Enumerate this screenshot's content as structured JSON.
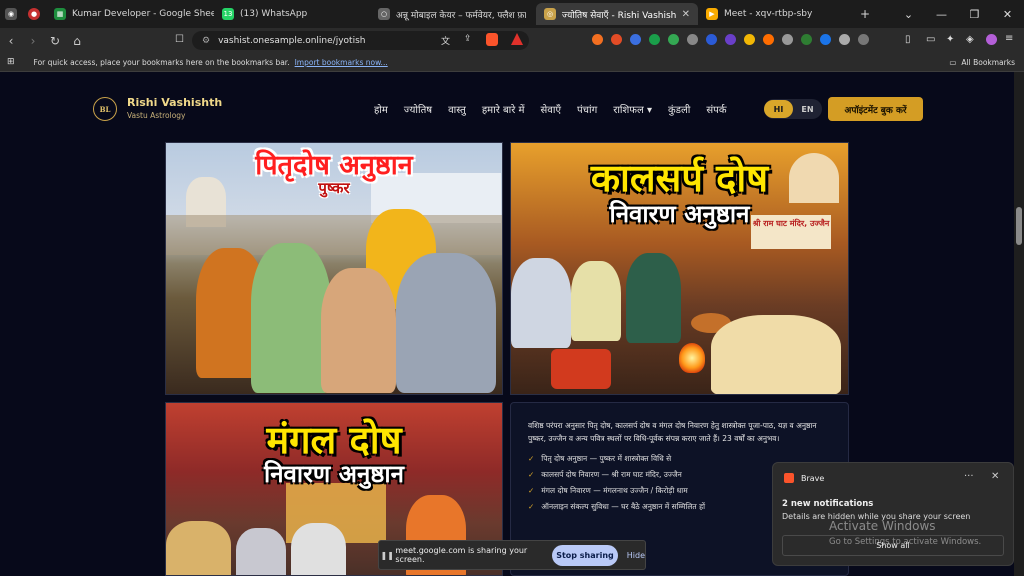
{
  "tabs": [
    {
      "title": "Kumar Developer - Google Sheets",
      "icon": "sheets-icon"
    },
    {
      "title": "(13) WhatsApp",
      "badge": "13",
      "icon": "whatsapp-icon"
    },
    {
      "title": "अन्नू मोबाइल केयर – फर्मवेयर, फ्लैश फ़ाइल",
      "icon": "page-icon"
    },
    {
      "title": "ज्योतिष सेवाएँ - Rishi Vashishth Vast",
      "icon": "page-icon"
    },
    {
      "title": "Meet - xqv-rtbp-sby",
      "icon": "meet-icon"
    }
  ],
  "url": "vashist.onesample.online/jyotish",
  "bookmarks": {
    "hint": "For quick access, place your bookmarks here on the bookmarks bar.",
    "import_link": "Import bookmarks now...",
    "all": "All Bookmarks"
  },
  "site": {
    "logo_text": "BL",
    "brand": "Rishi Vashishth",
    "tagline": "Vastu Astrology",
    "nav": [
      "होम",
      "ज्योतिष",
      "वास्तु",
      "हमारे बारे में",
      "सेवाएँ",
      "पंचांग",
      "राशिफल ▾",
      "कुंडली",
      "संपर्क"
    ],
    "lang_hi": "HI",
    "lang_en": "EN",
    "book_button": "अपॉइंटमेंट बुक करें"
  },
  "cards": {
    "pitru": {
      "title": "पितृदोष अनुष्ठान",
      "subtitle": "पुष्कर"
    },
    "kaalsarp": {
      "title": "कालसर्प दोष",
      "subtitle": "निवारण अनुष्ठान",
      "sign": "श्री राम घाट मंदिर, उज्जैन"
    },
    "mangal": {
      "title": "मंगल दोष",
      "subtitle": "निवारण अनुष्ठान"
    },
    "info": {
      "description": "वशिष्ठ परंपरा अनुसार पितृ दोष, कालसर्प दोष व मंगल दोष निवारण हेतु शास्त्रोक्त पूजा-पाठ, यज्ञ व अनुष्ठान पुष्कर, उज्जैन व अन्य पवित्र स्थलों पर विधि-पूर्वक संपन्न कराए जाते हैं। 23 वर्षों का अनुभव।",
      "items": [
        "पितृ दोष अनुष्ठान — पुष्कर में शास्त्रोक्त विधि से",
        "कालसर्प दोष निवारण — श्री राम घाट मंदिर, उज्जैन",
        "मंगल दोष निवारण — मंगलनाथ उज्जैन / किरोड़ी धाम",
        "ऑनलाइन संकल्प सुविधा — घर बैठे अनुष्ठान में सम्मिलित हों"
      ]
    }
  },
  "share_bar": {
    "message": "meet.google.com is sharing your screen.",
    "stop": "Stop sharing",
    "hide": "Hide"
  },
  "notification": {
    "app": "Brave",
    "title": "2 new notifications",
    "body": "Details are hidden while you share your screen",
    "action": "Show all"
  },
  "watermark": {
    "line1": "Activate Windows",
    "line2": "Go to Settings to activate Windows."
  }
}
